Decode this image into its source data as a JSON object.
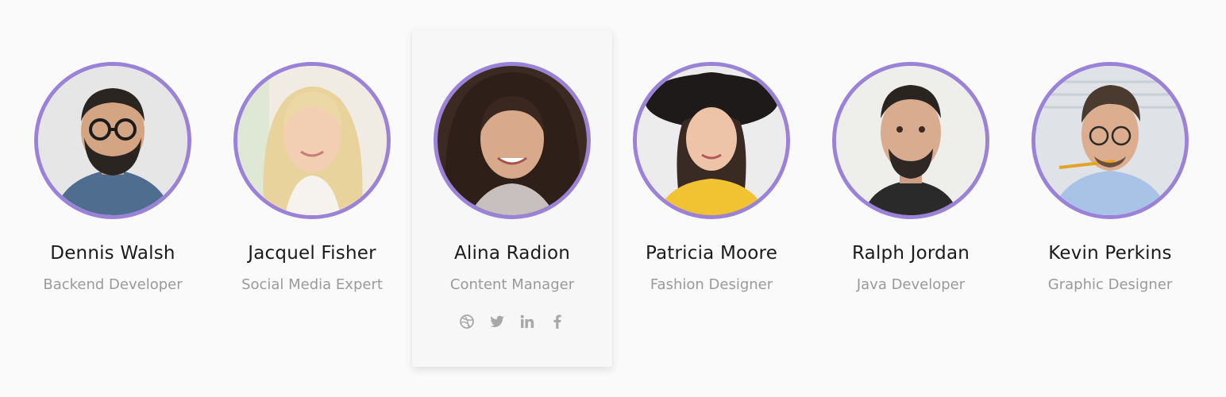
{
  "team": {
    "members": [
      {
        "name": "Dennis Walsh",
        "role": "Backend Developer"
      },
      {
        "name": "Jacquel Fisher",
        "role": "Social Media Expert"
      },
      {
        "name": "Alina Radion",
        "role": "Content Manager"
      },
      {
        "name": "Patricia Moore",
        "role": "Fashion Designer"
      },
      {
        "name": "Ralph Jordan",
        "role": "Java Developer"
      },
      {
        "name": "Kevin Perkins",
        "role": "Graphic Designer"
      }
    ],
    "active_member_socials": [
      "dribbble-icon",
      "twitter-icon",
      "linkedin-icon",
      "facebook-icon"
    ]
  },
  "colors": {
    "avatar_ring": "#9a82d8",
    "name_text": "#1b1b1b",
    "role_text": "#9a9a9a",
    "social_icon": "#a8a8a8",
    "page_background": "#fafafa",
    "active_card_background": "#f7f7f7"
  }
}
